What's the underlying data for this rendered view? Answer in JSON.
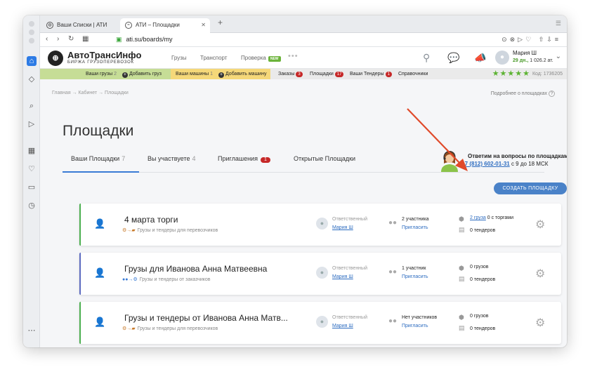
{
  "browser": {
    "tabs": [
      {
        "label": "Ваши Списки | АТИ"
      },
      {
        "label": "АТИ – Площадки"
      }
    ],
    "url": "ati.su/boards/my"
  },
  "header": {
    "brand": "АвтоТрансИнфо",
    "brand_sub": "БИРЖА ГРУЗОПЕРЕВОЗОК",
    "nav": [
      "Грузы",
      "Транспорт",
      "Проверка"
    ],
    "new_badge": "NEW",
    "user_name": "Мария Ш",
    "balance_days": "29 дн.,",
    "balance_amount": "1 026.2 ат."
  },
  "subbar": {
    "cargo_label": "Ваши грузы",
    "cargo_count": "2",
    "add_cargo": "Добавить груз",
    "trucks_label": "Ваши машины",
    "trucks_count": "1",
    "add_truck": "Добавить машину",
    "orders_label": "Заказы",
    "orders_count": "3",
    "boards_label": "Площадки",
    "boards_count": "17",
    "tenders_label": "Ваши Тендеры",
    "tenders_count": "1",
    "reference": "Справочники",
    "stars": "★★★★★",
    "code": "Код: 1736205"
  },
  "page": {
    "breadcrumb": "Главная → Кабинет → Площадки",
    "more_link": "Подробнее о площадках",
    "title": "Площадки",
    "tabs": [
      {
        "label": "Ваши Площадки",
        "count": "7"
      },
      {
        "label": "Вы участвуете",
        "count": "4"
      },
      {
        "label": "Приглашения",
        "badge": "1"
      },
      {
        "label": "Открытые Площадки"
      }
    ],
    "help_title": "Ответим на вопросы по площадкам",
    "help_phone": "+7 (812) 602-01-31",
    "help_hours": "с 9 до 18 МСК",
    "create_button": "СОЗДАТЬ ПЛОЩАДКУ"
  },
  "cards": [
    {
      "title": "4 марта торги",
      "subtitle": "Грузы и тендеры для перевозчиков",
      "stripe": "#4caf50",
      "responsible_label": "Ответственный",
      "responsible": "Мария Ш",
      "participants": "2 участника",
      "invite": "Пригласить",
      "cargo_link": "2 груза",
      "cargo_rest": "0 с торгами",
      "tenders": "0 тендеров"
    },
    {
      "title": "Грузы для Иванова Анна Матвеевна",
      "subtitle": "Грузы и тендеры от заказчиков",
      "stripe": "#5c6bc0",
      "responsible_label": "Ответственный",
      "responsible": "Мария Ш",
      "participants": "1 участник",
      "invite": "Пригласить",
      "cargo_link": "",
      "cargo_rest": "0 грузов",
      "tenders": "0 тендеров"
    },
    {
      "title": "Грузы и тендеры от Иванова Анна Матв...",
      "subtitle": "Грузы и тендеры для перевозчиков",
      "stripe": "#4caf50",
      "responsible_label": "Ответственный",
      "responsible": "Мария Ш",
      "participants": "Нет участников",
      "invite": "Пригласить",
      "cargo_link": "",
      "cargo_rest": "0 грузов",
      "tenders": "0 тендеров"
    }
  ],
  "colors": {
    "accent": "#4a82c8",
    "arrow": "#e04a2a",
    "green": "#6bb33a"
  }
}
